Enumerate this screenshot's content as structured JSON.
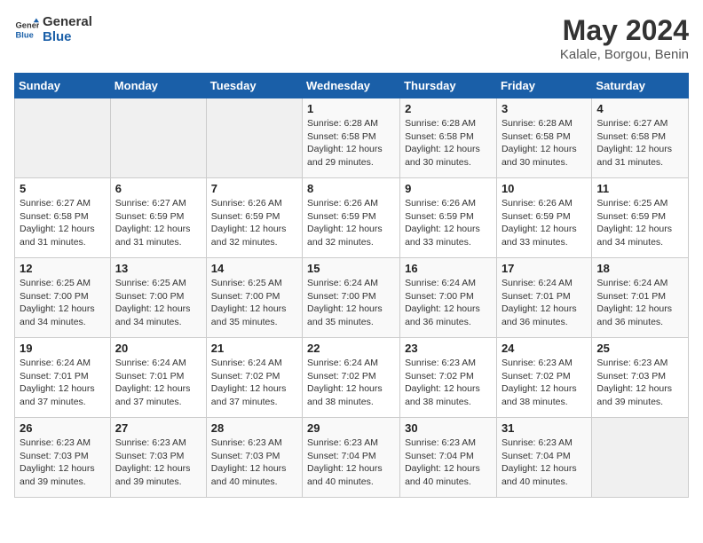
{
  "logo": {
    "line1": "General",
    "line2": "Blue"
  },
  "title": "May 2024",
  "subtitle": "Kalale, Borgou, Benin",
  "days_of_week": [
    "Sunday",
    "Monday",
    "Tuesday",
    "Wednesday",
    "Thursday",
    "Friday",
    "Saturday"
  ],
  "weeks": [
    [
      {
        "day": "",
        "info": ""
      },
      {
        "day": "",
        "info": ""
      },
      {
        "day": "",
        "info": ""
      },
      {
        "day": "1",
        "info": "Sunrise: 6:28 AM\nSunset: 6:58 PM\nDaylight: 12 hours\nand 29 minutes."
      },
      {
        "day": "2",
        "info": "Sunrise: 6:28 AM\nSunset: 6:58 PM\nDaylight: 12 hours\nand 30 minutes."
      },
      {
        "day": "3",
        "info": "Sunrise: 6:28 AM\nSunset: 6:58 PM\nDaylight: 12 hours\nand 30 minutes."
      },
      {
        "day": "4",
        "info": "Sunrise: 6:27 AM\nSunset: 6:58 PM\nDaylight: 12 hours\nand 31 minutes."
      }
    ],
    [
      {
        "day": "5",
        "info": "Sunrise: 6:27 AM\nSunset: 6:58 PM\nDaylight: 12 hours\nand 31 minutes."
      },
      {
        "day": "6",
        "info": "Sunrise: 6:27 AM\nSunset: 6:59 PM\nDaylight: 12 hours\nand 31 minutes."
      },
      {
        "day": "7",
        "info": "Sunrise: 6:26 AM\nSunset: 6:59 PM\nDaylight: 12 hours\nand 32 minutes."
      },
      {
        "day": "8",
        "info": "Sunrise: 6:26 AM\nSunset: 6:59 PM\nDaylight: 12 hours\nand 32 minutes."
      },
      {
        "day": "9",
        "info": "Sunrise: 6:26 AM\nSunset: 6:59 PM\nDaylight: 12 hours\nand 33 minutes."
      },
      {
        "day": "10",
        "info": "Sunrise: 6:26 AM\nSunset: 6:59 PM\nDaylight: 12 hours\nand 33 minutes."
      },
      {
        "day": "11",
        "info": "Sunrise: 6:25 AM\nSunset: 6:59 PM\nDaylight: 12 hours\nand 34 minutes."
      }
    ],
    [
      {
        "day": "12",
        "info": "Sunrise: 6:25 AM\nSunset: 7:00 PM\nDaylight: 12 hours\nand 34 minutes."
      },
      {
        "day": "13",
        "info": "Sunrise: 6:25 AM\nSunset: 7:00 PM\nDaylight: 12 hours\nand 34 minutes."
      },
      {
        "day": "14",
        "info": "Sunrise: 6:25 AM\nSunset: 7:00 PM\nDaylight: 12 hours\nand 35 minutes."
      },
      {
        "day": "15",
        "info": "Sunrise: 6:24 AM\nSunset: 7:00 PM\nDaylight: 12 hours\nand 35 minutes."
      },
      {
        "day": "16",
        "info": "Sunrise: 6:24 AM\nSunset: 7:00 PM\nDaylight: 12 hours\nand 36 minutes."
      },
      {
        "day": "17",
        "info": "Sunrise: 6:24 AM\nSunset: 7:01 PM\nDaylight: 12 hours\nand 36 minutes."
      },
      {
        "day": "18",
        "info": "Sunrise: 6:24 AM\nSunset: 7:01 PM\nDaylight: 12 hours\nand 36 minutes."
      }
    ],
    [
      {
        "day": "19",
        "info": "Sunrise: 6:24 AM\nSunset: 7:01 PM\nDaylight: 12 hours\nand 37 minutes."
      },
      {
        "day": "20",
        "info": "Sunrise: 6:24 AM\nSunset: 7:01 PM\nDaylight: 12 hours\nand 37 minutes."
      },
      {
        "day": "21",
        "info": "Sunrise: 6:24 AM\nSunset: 7:02 PM\nDaylight: 12 hours\nand 37 minutes."
      },
      {
        "day": "22",
        "info": "Sunrise: 6:24 AM\nSunset: 7:02 PM\nDaylight: 12 hours\nand 38 minutes."
      },
      {
        "day": "23",
        "info": "Sunrise: 6:23 AM\nSunset: 7:02 PM\nDaylight: 12 hours\nand 38 minutes."
      },
      {
        "day": "24",
        "info": "Sunrise: 6:23 AM\nSunset: 7:02 PM\nDaylight: 12 hours\nand 38 minutes."
      },
      {
        "day": "25",
        "info": "Sunrise: 6:23 AM\nSunset: 7:03 PM\nDaylight: 12 hours\nand 39 minutes."
      }
    ],
    [
      {
        "day": "26",
        "info": "Sunrise: 6:23 AM\nSunset: 7:03 PM\nDaylight: 12 hours\nand 39 minutes."
      },
      {
        "day": "27",
        "info": "Sunrise: 6:23 AM\nSunset: 7:03 PM\nDaylight: 12 hours\nand 39 minutes."
      },
      {
        "day": "28",
        "info": "Sunrise: 6:23 AM\nSunset: 7:03 PM\nDaylight: 12 hours\nand 40 minutes."
      },
      {
        "day": "29",
        "info": "Sunrise: 6:23 AM\nSunset: 7:04 PM\nDaylight: 12 hours\nand 40 minutes."
      },
      {
        "day": "30",
        "info": "Sunrise: 6:23 AM\nSunset: 7:04 PM\nDaylight: 12 hours\nand 40 minutes."
      },
      {
        "day": "31",
        "info": "Sunrise: 6:23 AM\nSunset: 7:04 PM\nDaylight: 12 hours\nand 40 minutes."
      },
      {
        "day": "",
        "info": ""
      }
    ]
  ]
}
